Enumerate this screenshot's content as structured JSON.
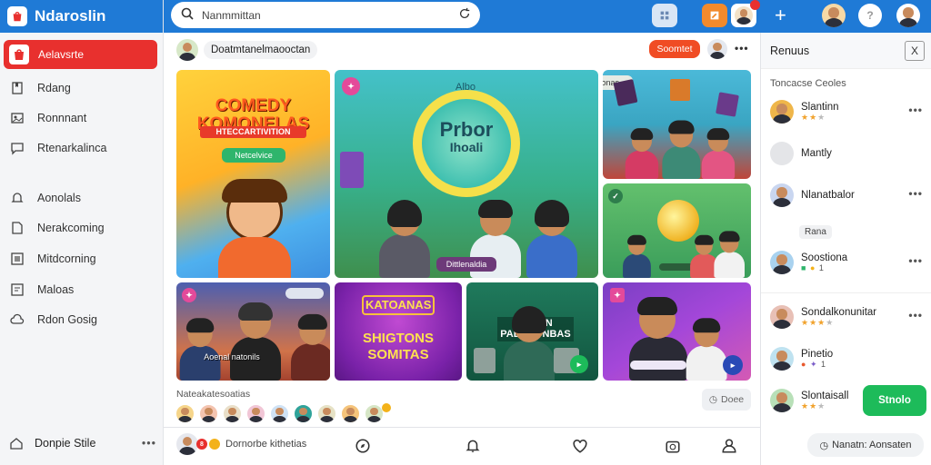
{
  "app": {
    "title": "Ndaroslin"
  },
  "search": {
    "value": "Nanmmittan"
  },
  "sidebar": {
    "active": {
      "label": "Aelavsrte",
      "icon": "bag-icon"
    },
    "items": [
      {
        "label": "Rdang",
        "icon": "bookmark-icon"
      },
      {
        "label": "Ronnnant",
        "icon": "image-icon"
      },
      {
        "label": "Rtenarkalinca",
        "icon": "chat-icon"
      },
      {
        "label": "Aonolals",
        "icon": "bell-icon"
      },
      {
        "label": "Nerakcoming",
        "icon": "calendar-icon"
      },
      {
        "label": "Mitdcorning",
        "icon": "grid-icon"
      },
      {
        "label": "Maloas",
        "icon": "play-icon"
      },
      {
        "label": "Rdon Gosig",
        "icon": "cloud-icon"
      }
    ],
    "bottom": {
      "label": "Donpie Stile",
      "more": "•••"
    }
  },
  "main": {
    "user_chip": "Doatmtanelmaooctan",
    "follow_label": "Soomtet",
    "more": "•••",
    "tiles": {
      "t1_title": "COMEDY KOMONELAS",
      "t1_subtitle": "HTECCARTIVITION",
      "t1_chip": "Netcelvice",
      "t2_title": "Prbor",
      "t2_subtitle": "Ihoali",
      "t2_top": "Albo",
      "t2_chip": "Dittlenaldia",
      "t3_chip": "Dnting stoonas",
      "t5_chip": "Aoenal natonils",
      "t6_title": "KATOANAS",
      "t6_line1": "SHIGTONS",
      "t6_line2": "SOMITAS",
      "t7_title": "IRSNIN PALOCONBAS"
    },
    "friends_title": "Nateakatesoatias",
    "done_label": "Doee"
  },
  "bottombar": {
    "user_label": "Dornorbe kithetias"
  },
  "rpanel": {
    "title": "Renuus",
    "close": "X",
    "subtitle": "Toncacse Ceoles",
    "tag": "Rana",
    "cta": "Stnolo",
    "items": [
      {
        "name": "Slantinn",
        "stars": 2,
        "extra": ""
      },
      {
        "name": "Mantly",
        "stars": 0,
        "extra": ""
      },
      {
        "name": "Nlanatbalor",
        "stars": 0,
        "extra": ""
      },
      {
        "name": "Soostiona",
        "stars": 0,
        "extra": "1"
      },
      {
        "name": "Sondalkonunitar",
        "stars": 3,
        "extra": ""
      },
      {
        "name": "Pinetio",
        "stars": 0,
        "extra": "1"
      },
      {
        "name": "Slontaisall",
        "stars": 2,
        "extra": ""
      }
    ]
  },
  "bottom_right": {
    "label": "Nanatn: Aonsaten"
  },
  "colors": {
    "brand": "#1f7ad6",
    "active": "#e8302e",
    "follow": "#f04c24",
    "cta": "#1dbb5a"
  }
}
